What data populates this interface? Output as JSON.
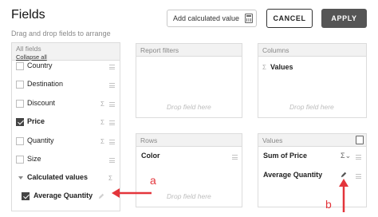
{
  "header": {
    "title": "Fields",
    "subtitle": "Drag and drop fields to arrange",
    "add_calculated_label": "Add calculated value",
    "cancel_label": "CANCEL",
    "apply_label": "APPLY"
  },
  "all_fields": {
    "heading": "All fields",
    "collapse_label": "Collapse all",
    "items": [
      {
        "label": "Country",
        "checked": false
      },
      {
        "label": "Destination",
        "checked": false
      },
      {
        "label": "Discount",
        "checked": false
      },
      {
        "label": "Price",
        "checked": true
      },
      {
        "label": "Quantity",
        "checked": false
      },
      {
        "label": "Size",
        "checked": false
      }
    ],
    "group_label": "Calculated values",
    "calculated_item": {
      "label": "Average Quantity",
      "checked": true
    }
  },
  "report_filters": {
    "heading": "Report filters",
    "drop_text": "Drop field here"
  },
  "columns": {
    "heading": "Columns",
    "items": [
      "Values"
    ],
    "drop_text": "Drop field here"
  },
  "rows": {
    "heading": "Rows",
    "items": [
      "Color"
    ],
    "drop_text": "Drop field here"
  },
  "values": {
    "heading": "Values",
    "items": [
      "Sum of Price",
      "Average Quantity"
    ]
  },
  "annotations": {
    "a": "a",
    "b": "b",
    "color": "#e3353b"
  },
  "colors": {
    "apply_bg": "#555555",
    "panel_head_bg": "#f2f2f2",
    "border": "#dcdcdc"
  }
}
